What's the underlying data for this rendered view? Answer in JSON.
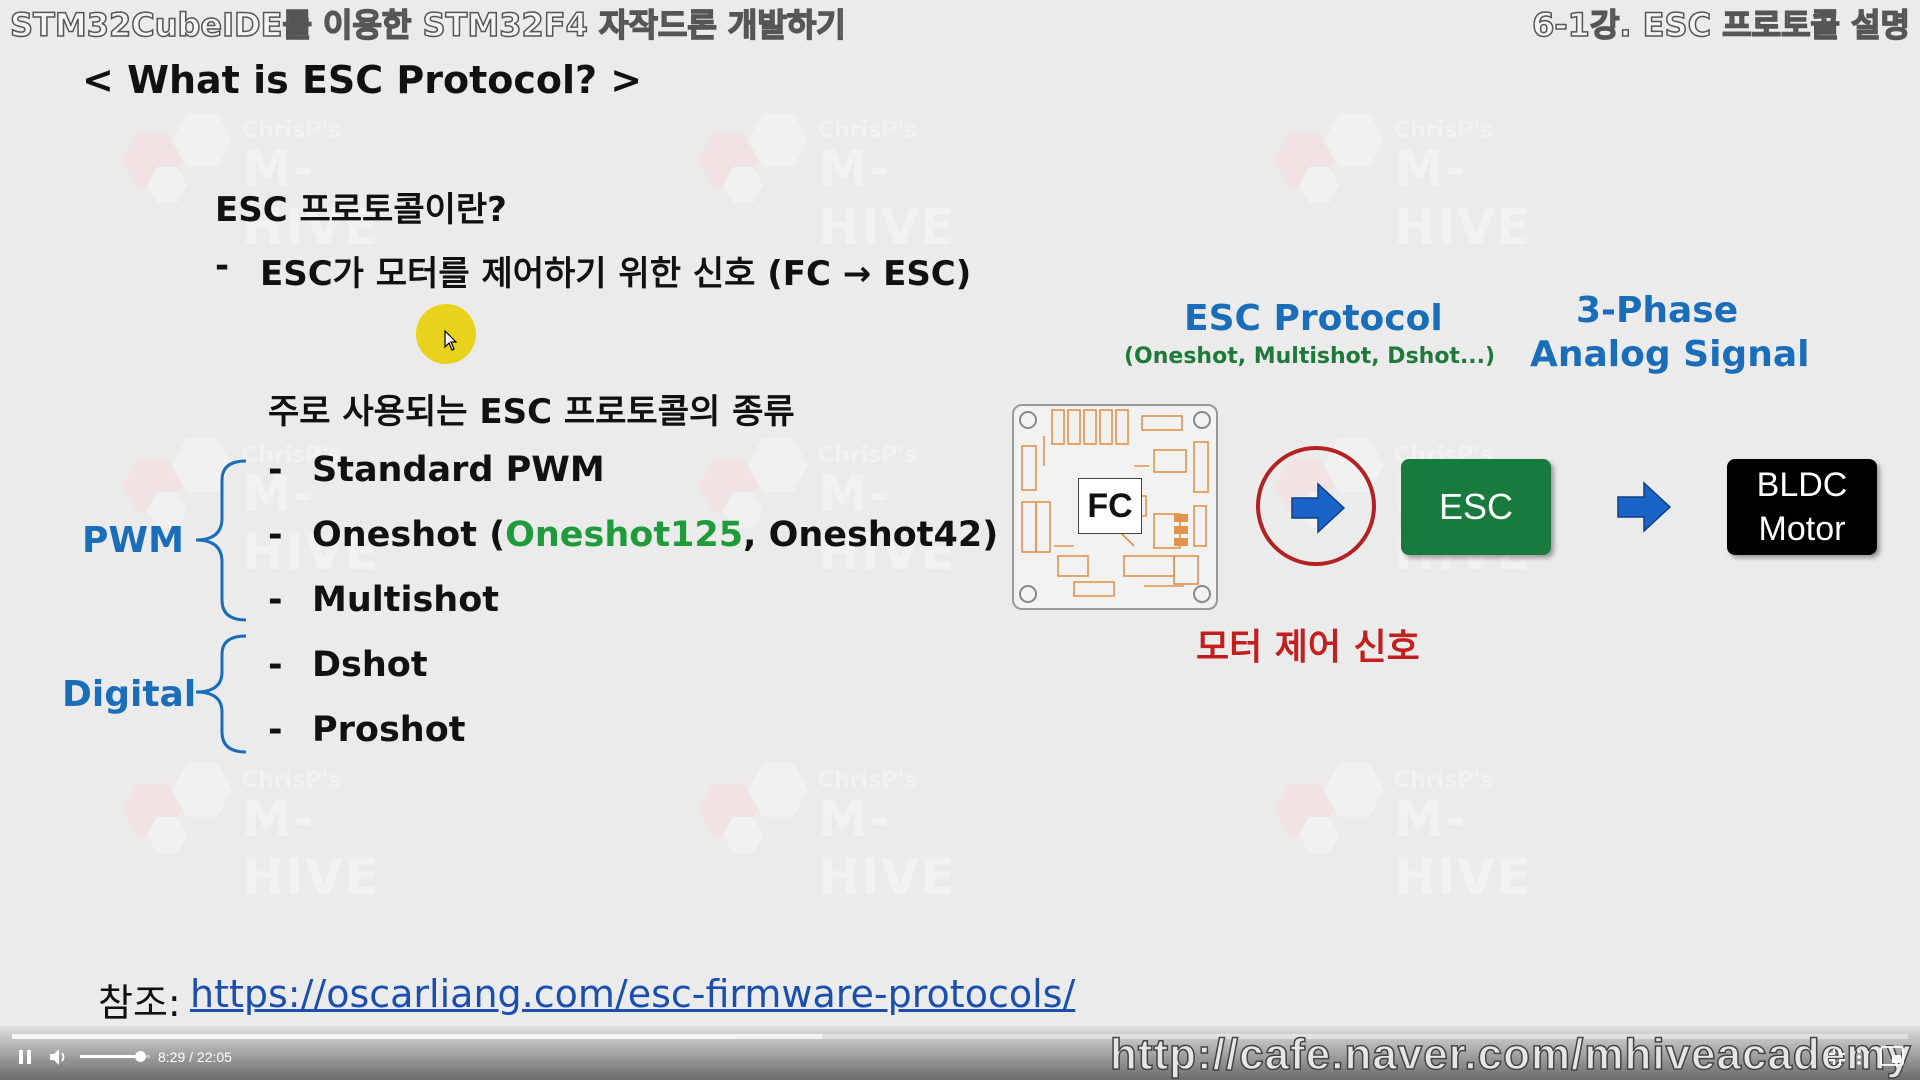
{
  "header": {
    "course_title": "STM32CubeIDE를 이용한 STM32F4 자작드론 개발하기",
    "lecture_title": "6-1강. ESC 프로토콜 설명"
  },
  "watermark": {
    "line1": "ChrisP's",
    "line2": "M-HIVE"
  },
  "slide": {
    "title": "< What is ESC Protocol? >",
    "question": "ESC 프로토콜이란?",
    "definition_dash": "-",
    "definition": "ESC가 모터를 제어하기 위한 신호 (FC → ESC)",
    "types_heading": "주로 사용되는 ESC 프로토콜의 종류",
    "groups": {
      "pwm": "PWM",
      "digital": "Digital"
    },
    "items": {
      "standard_pwm": "Standard PWM",
      "oneshot_prefix": "Oneshot (",
      "oneshot125": "Oneshot125",
      "oneshot_mid": ", Oneshot42)",
      "multishot": "Multishot",
      "dshot": "Dshot",
      "proshot": "Proshot"
    },
    "dash": "-",
    "diagram": {
      "protocol_title": "ESC Protocol",
      "protocol_sub": "(Oneshot, Multishot, Dshot...)",
      "phase_line1": "3-Phase",
      "phase_line2": "Analog Signal",
      "fc_label": "FC",
      "esc_label": "ESC",
      "motor_line1": "BLDC",
      "motor_line2": "Motor",
      "signal_caption": "모터 제어 신호"
    },
    "reference_label": "참조: ",
    "reference_url": "https://oscarliang.com/esc-firmware-protocols/"
  },
  "player": {
    "time_current": "8:29",
    "time_separator": "/",
    "time_total": "22:05",
    "progress": 0.384,
    "buffered": 0.427,
    "volume": 0.85,
    "watermark_url": "http://cafe.naver.com/mhiveacademy"
  },
  "colors": {
    "accent_blue": "#1a6db8",
    "green": "#1f9b3b",
    "red": "#c41f1f",
    "esc_green": "#187a3c"
  }
}
